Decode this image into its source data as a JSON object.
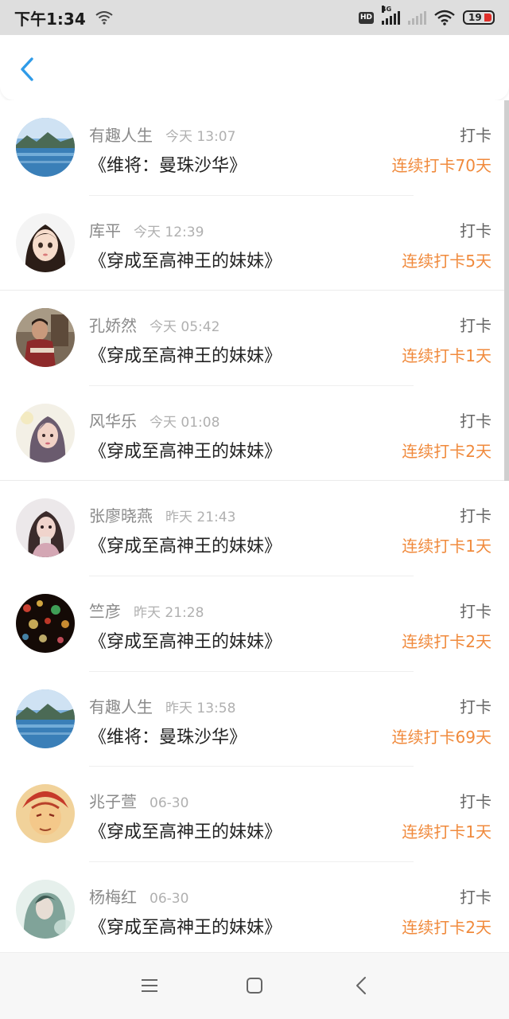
{
  "status_bar": {
    "time": "下午1:34",
    "hd_badge": "HD",
    "network_type": "4G",
    "battery_level": "19"
  },
  "nav": {
    "back_icon": "chevron-left-icon"
  },
  "colors": {
    "accent_blue": "#2f9be8",
    "streak_orange": "#f08a3c"
  },
  "checkins": [
    {
      "name": "有趣人生",
      "time": "今天 13:07",
      "book": "《维将：曼珠沙华》",
      "action": "打卡",
      "streak": "连续打卡70天"
    },
    {
      "name": "库平",
      "time": "今天 12:39",
      "book": "《穿成至高神王的妹妹》",
      "action": "打卡",
      "streak": "连续打卡5天"
    },
    {
      "name": "孔娇然",
      "time": "今天 05:42",
      "book": "《穿成至高神王的妹妹》",
      "action": "打卡",
      "streak": "连续打卡1天"
    },
    {
      "name": "风华乐",
      "time": "今天 01:08",
      "book": "《穿成至高神王的妹妹》",
      "action": "打卡",
      "streak": "连续打卡2天"
    },
    {
      "name": "张廖晓燕",
      "time": "昨天 21:43",
      "book": "《穿成至高神王的妹妹》",
      "action": "打卡",
      "streak": "连续打卡1天"
    },
    {
      "name": "竺彦",
      "time": "昨天 21:28",
      "book": "《穿成至高神王的妹妹》",
      "action": "打卡",
      "streak": "连续打卡2天"
    },
    {
      "name": "有趣人生",
      "time": "昨天 13:58",
      "book": "《维将：曼珠沙华》",
      "action": "打卡",
      "streak": "连续打卡69天"
    },
    {
      "name": "兆子萱",
      "time": "06-30",
      "book": "《穿成至高神王的妹妹》",
      "action": "打卡",
      "streak": "连续打卡1天"
    },
    {
      "name": "杨梅红",
      "time": "06-30",
      "book": "《穿成至高神王的妹妹》",
      "action": "打卡",
      "streak": "连续打卡2天"
    }
  ],
  "bottom_nav": {
    "menu_icon": "menu-icon",
    "home_icon": "home-square-icon",
    "back_icon": "back-triangle-icon"
  }
}
